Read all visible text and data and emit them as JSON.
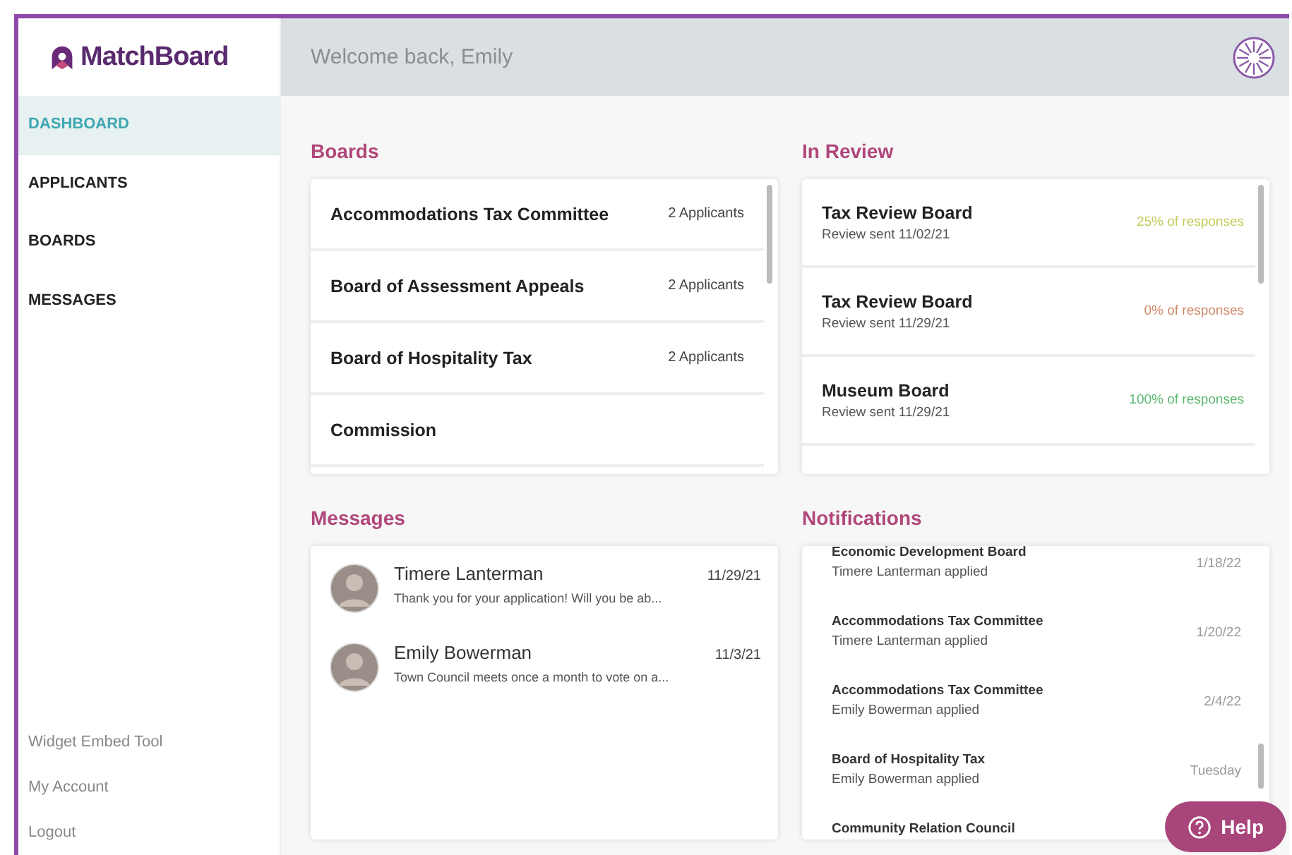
{
  "logo": {
    "text": "MatchBoard"
  },
  "header": {
    "greeting": "Welcome back, Emily"
  },
  "sidebar": {
    "items": [
      {
        "label": "DASHBOARD",
        "selected": true
      },
      {
        "label": "APPLICANTS",
        "selected": false
      },
      {
        "label": "BOARDS",
        "selected": false
      },
      {
        "label": "MESSAGES",
        "selected": false
      }
    ],
    "footer_links": [
      "Widget Embed Tool",
      "My Account",
      "Logout"
    ]
  },
  "boards": {
    "title": "Boards",
    "rows": [
      {
        "name": "Accommodations Tax Committee",
        "count": "2 Applicants"
      },
      {
        "name": "Board of Assessment Appeals",
        "count": "2 Applicants"
      },
      {
        "name": "Board of Hospitality Tax",
        "count": "2 Applicants"
      },
      {
        "name": "Commission"
      }
    ]
  },
  "in_review": {
    "title": "In Review",
    "rows": [
      {
        "name": "Tax Review Board",
        "sent": "Review sent 11/02/21",
        "responses": "25% of responses",
        "color": "#c4cc5a"
      },
      {
        "name": "Tax Review Board",
        "sent": "Review sent 11/29/21",
        "responses": "0% of responses",
        "color": "#d0896a"
      },
      {
        "name": "Museum Board",
        "sent": "Review sent 11/29/21",
        "responses": "100% of responses",
        "color": "#5bb86f"
      }
    ]
  },
  "messages": {
    "title": "Messages",
    "rows": [
      {
        "sender": "Timere Lanterman",
        "preview": "Thank you for your application! Will you be ab...",
        "date": "11/29/21"
      },
      {
        "sender": "Emily Bowerman",
        "preview": "Town Council meets once a month to vote on a...",
        "date": "11/3/21"
      }
    ]
  },
  "notifications": {
    "title": "Notifications",
    "rows": [
      {
        "board": "Economic Development Board",
        "detail": "Timere Lanterman applied",
        "date": "1/18/22"
      },
      {
        "board": "Accommodations Tax Committee",
        "detail": "Timere Lanterman applied",
        "date": "1/20/22"
      },
      {
        "board": "Accommodations Tax Committee",
        "detail": "Emily Bowerman applied",
        "date": "2/4/22"
      },
      {
        "board": "Board of Hospitality Tax",
        "detail": "Emily Bowerman applied",
        "date": "Tuesday"
      },
      {
        "board": "Community Relation Council"
      }
    ]
  },
  "help_button": {
    "label": "Help"
  }
}
